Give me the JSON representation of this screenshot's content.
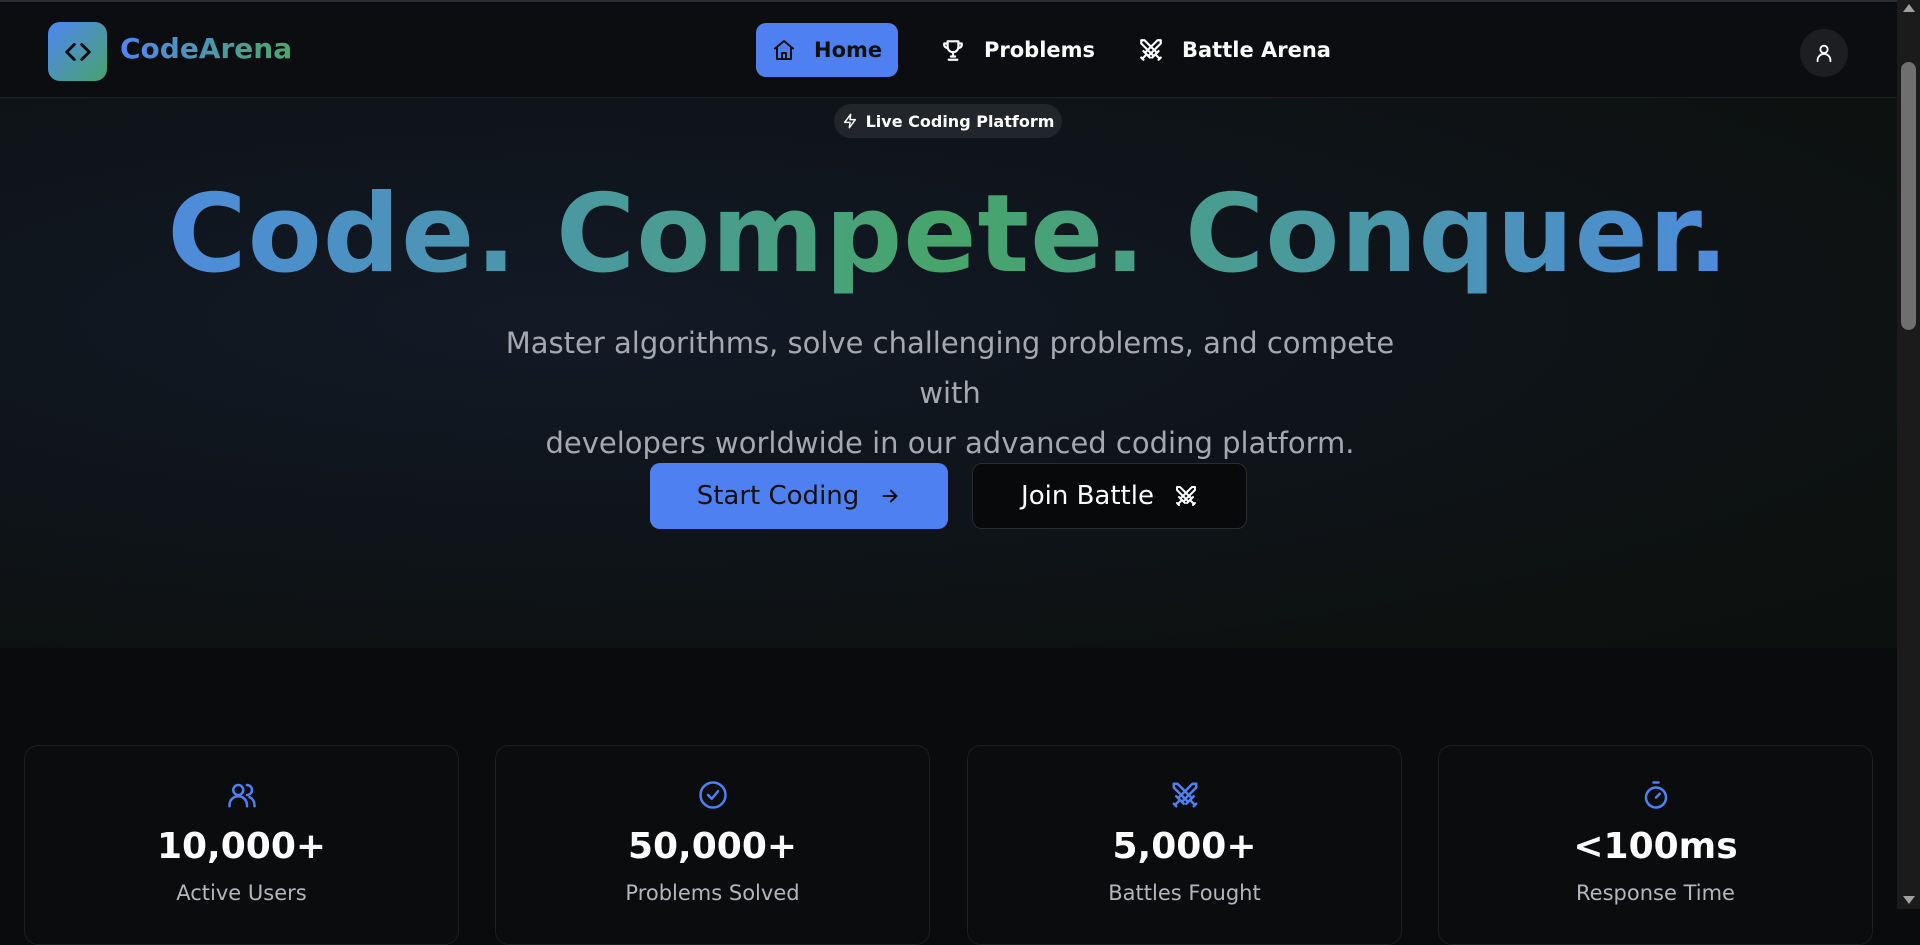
{
  "brand": {
    "name": "CodeArena",
    "logo_icon": "code-brackets-icon"
  },
  "nav": {
    "items": [
      {
        "label": "Home",
        "icon": "home-icon",
        "active": true
      },
      {
        "label": "Problems",
        "icon": "trophy-icon",
        "active": false
      },
      {
        "label": "Battle Arena",
        "icon": "crossed-swords-icon",
        "active": false
      }
    ],
    "profile_icon": "user-icon"
  },
  "hero": {
    "badge": "Live Coding Platform",
    "title": "Code. Compete. Conquer.",
    "subtitle_line1": "Master algorithms, solve challenging problems, and compete with",
    "subtitle_line2": "developers worldwide in our advanced coding platform.",
    "primary_button": "Start Coding",
    "secondary_button": "Join Battle"
  },
  "stats": [
    {
      "value": "10,000+",
      "label": "Active Users",
      "icon": "users-icon"
    },
    {
      "value": "50,000+",
      "label": "Problems Solved",
      "icon": "check-circle-icon"
    },
    {
      "value": "5,000+",
      "label": "Battles Fought",
      "icon": "crossed-swords-icon"
    },
    {
      "value": "<100ms",
      "label": "Response Time",
      "icon": "timer-icon"
    }
  ],
  "colors": {
    "accent": "#4f80f1",
    "green": "#47a56a",
    "background": "#0a0b0d"
  }
}
